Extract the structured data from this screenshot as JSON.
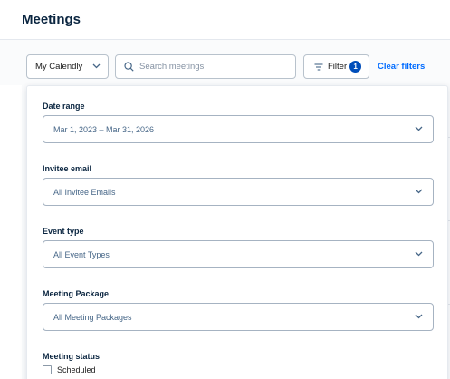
{
  "header": {
    "title": "Meetings"
  },
  "toolbar": {
    "calendar_select": "My Calendly",
    "search_placeholder": "Search meetings",
    "filter_label": "Filter",
    "filter_count": "1",
    "clear_filters": "Clear filters"
  },
  "filters": {
    "date_range": {
      "label": "Date range",
      "value": "Mar 1, 2023 – Mar 31, 2026"
    },
    "invitee_email": {
      "label": "Invitee email",
      "value": "All Invitee Emails"
    },
    "event_type": {
      "label": "Event type",
      "value": "All Event Types"
    },
    "meeting_package": {
      "label": "Meeting Package",
      "value": "All Meeting Packages"
    },
    "meeting_status": {
      "label": "Meeting status",
      "options": [
        {
          "label": "Scheduled",
          "checked": false
        }
      ]
    }
  },
  "colors": {
    "accent": "#006bff",
    "badge": "#004eba",
    "title": "#0a2540",
    "select_text": "#476788"
  },
  "icons": {
    "search": "search-icon",
    "filter": "filter-icon",
    "dropdown": "chevron-down-icon"
  }
}
